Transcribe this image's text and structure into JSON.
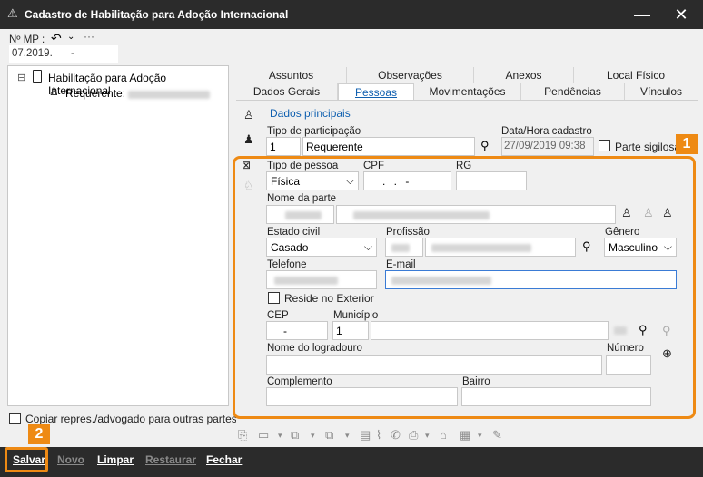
{
  "window": {
    "title": "Cadastro de Habilitação para Adoção Internacional"
  },
  "mp": {
    "label": "Nº MP :",
    "value": "07.2019.",
    "value2": "-"
  },
  "tree": {
    "root": "Habilitação para Adoção Internacional",
    "child": "Requerente:"
  },
  "tabs_top": [
    "Assuntos",
    "Observações",
    "Anexos",
    "Local Físico"
  ],
  "tabs_bottom": [
    "Dados Gerais",
    "Pessoas",
    "Movimentações",
    "Pendências",
    "Vínculos"
  ],
  "subtab": "Dados principais",
  "form": {
    "tipo_participacao_label": "Tipo de participação",
    "tipo_participacao_code": "1",
    "tipo_participacao_value": "Requerente",
    "data_hora_label": "Data/Hora cadastro",
    "data_hora_value": "27/09/2019 09:38",
    "parte_sigilosa_label": "Parte sigilosa",
    "tipo_pessoa_label": "Tipo de pessoa",
    "tipo_pessoa_value": "Física",
    "cpf_label": "CPF",
    "cpf_value": ". . -",
    "rg_label": "RG",
    "nome_label": "Nome da parte",
    "estado_civil_label": "Estado civil",
    "estado_civil_value": "Casado",
    "profissao_label": "Profissão",
    "genero_label": "Gênero",
    "genero_value": "Masculino",
    "telefone_label": "Telefone",
    "email_label": "E-mail",
    "reside_exterior_label": "Reside no Exterior",
    "cep_label": "CEP",
    "cep_value": "-",
    "municipio_label": "Município",
    "municipio_code": "1",
    "logradouro_label": "Nome do logradouro",
    "numero_label": "Número",
    "complemento_label": "Complemento",
    "bairro_label": "Bairro"
  },
  "copiar_label": "Copiar repres./advogado para outras partes",
  "callouts": [
    "1",
    "2"
  ],
  "bottom_buttons": [
    "Salvar",
    "Novo",
    "Limpar",
    "Restaurar",
    "Fechar"
  ],
  "colors": {
    "titlebar": "#2b2b2b",
    "accent": "#ee8a14",
    "link": "#1060b0"
  }
}
